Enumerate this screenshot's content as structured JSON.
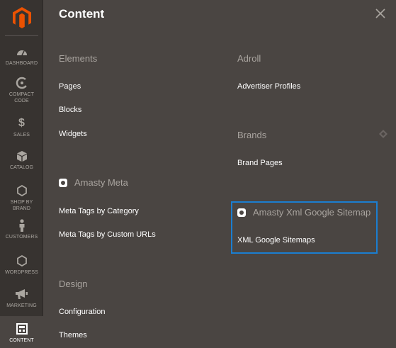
{
  "sidebar": {
    "items": [
      {
        "label": "DASHBOARD",
        "icon": "dashboard-icon"
      },
      {
        "label": "COMPACT\nCODE",
        "icon": "compact-code-icon"
      },
      {
        "label": "SALES",
        "icon": "dollar-icon"
      },
      {
        "label": "CATALOG",
        "icon": "cube-icon"
      },
      {
        "label": "SHOP BY\nBRAND",
        "icon": "hexagon-icon"
      },
      {
        "label": "CUSTOMERS",
        "icon": "person-icon"
      },
      {
        "label": "WORDPRESS",
        "icon": "hexagon-icon"
      },
      {
        "label": "MARKETING",
        "icon": "megaphone-icon"
      },
      {
        "label": "CONTENT",
        "icon": "content-layout-icon",
        "active": true
      }
    ]
  },
  "panel": {
    "title": "Content",
    "left_column": {
      "elements": {
        "title": "Elements",
        "links": [
          "Pages",
          "Blocks",
          "Widgets"
        ]
      },
      "amasty_meta": {
        "title": "Amasty Meta",
        "links": [
          "Meta Tags by Category",
          "Meta Tags by Custom URLs"
        ]
      },
      "design": {
        "title": "Design",
        "links": [
          "Configuration",
          "Themes"
        ]
      }
    },
    "right_column": {
      "adroll": {
        "title": "Adroll",
        "links": [
          "Advertiser Profiles"
        ]
      },
      "brands": {
        "title": "Brands",
        "links": [
          "Brand Pages"
        ]
      },
      "amasty_sitemap": {
        "title": "Amasty Xml Google Sitemap",
        "links": [
          "XML Google Sitemaps"
        ]
      }
    }
  },
  "colors": {
    "sidebar_bg": "#373330",
    "panel_bg": "#4a4542",
    "highlight": "#1b7ed0",
    "logo": "#eb5202"
  }
}
